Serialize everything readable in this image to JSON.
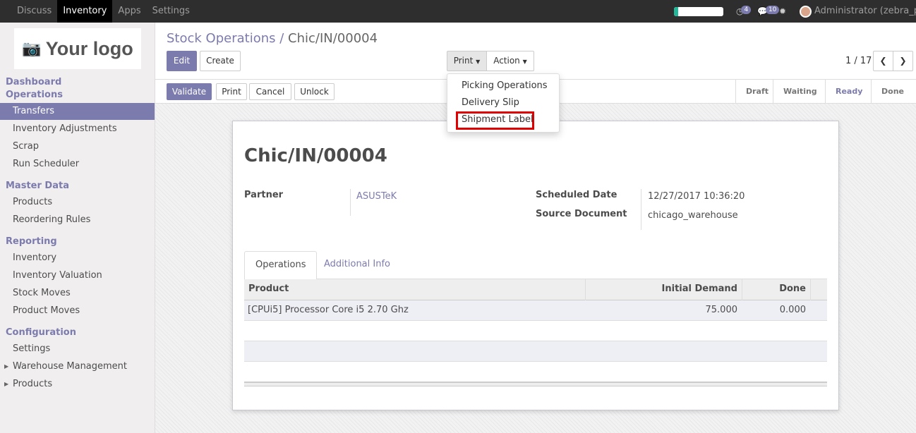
{
  "topbar": {
    "menu": [
      "Discuss",
      "Inventory",
      "Apps",
      "Settings"
    ],
    "active_menu": "Inventory",
    "progress_fraction": 0.08,
    "activity_count": "4",
    "messages_count": "10",
    "user_label": "Administrator (zebra_pr..."
  },
  "sidebar": {
    "logo_text": "Your logo",
    "sections": [
      {
        "title": "Dashboard",
        "items": []
      },
      {
        "title": "Operations",
        "items": [
          "Transfers",
          "Inventory Adjustments",
          "Scrap",
          "Run Scheduler"
        ]
      },
      {
        "title": "Master Data",
        "items": [
          "Products",
          "Reordering Rules"
        ]
      },
      {
        "title": "Reporting",
        "items": [
          "Inventory",
          "Inventory Valuation",
          "Stock Moves",
          "Product Moves"
        ]
      },
      {
        "title": "Configuration",
        "items": [
          "Settings",
          "Warehouse Management",
          "Products"
        ]
      }
    ],
    "active_item": "Transfers"
  },
  "control_panel": {
    "breadcrumb_parent": "Stock Operations",
    "breadcrumb_sep": "/",
    "breadcrumb_current": "Chic/IN/00004",
    "edit_label": "Edit",
    "create_label": "Create",
    "print_label": "Print",
    "action_label": "Action",
    "pager": "1 / 17"
  },
  "statusbar": {
    "validate_label": "Validate",
    "print_label": "Print",
    "cancel_label": "Cancel",
    "unlock_label": "Unlock",
    "stages": [
      "Draft",
      "Waiting",
      "Ready",
      "Done"
    ],
    "current_stage": "Ready"
  },
  "print_menu": {
    "items": [
      "Picking Operations",
      "Delivery Slip",
      "Shipment Label"
    ],
    "highlighted": "Shipment Label",
    "highlight_color": "#e00000"
  },
  "form": {
    "title": "Chic/IN/00004",
    "partner_label": "Partner",
    "partner_value": "ASUSTeK",
    "scheduled_date_label": "Scheduled Date",
    "scheduled_date_value": "12/27/2017 10:36:20",
    "source_doc_label": "Source Document",
    "source_doc_value": "chicago_warehouse",
    "tabs": [
      "Operations",
      "Additional Info"
    ],
    "active_tab": "Operations",
    "table": {
      "columns": [
        "Product",
        "Initial Demand",
        "Done"
      ],
      "rows": [
        {
          "product": "[CPUi5] Processor Core i5 2.70 Ghz",
          "initial_demand": "75.000",
          "done": "0.000"
        }
      ]
    }
  },
  "colors": {
    "accent": "#7c7bad",
    "topbar": "#2e2e2e",
    "sidebar_bg": "#f0eeee"
  }
}
